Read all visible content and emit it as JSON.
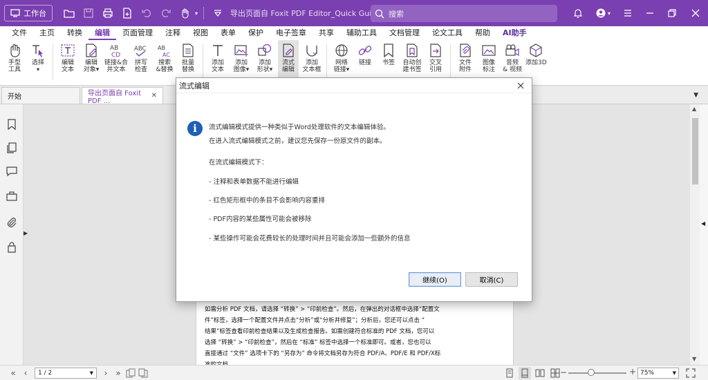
{
  "titlebar": {
    "home_label": "工作台",
    "doc_title": "导出页面自 Foxit PDF Editor_Quick Guide.pdf",
    "search_placeholder": "搜索"
  },
  "menu": {
    "tabs": [
      "文件",
      "主页",
      "转换",
      "编辑",
      "页面管理",
      "注释",
      "视图",
      "表单",
      "保护",
      "电子签章",
      "共享",
      "辅助工具",
      "文档管理",
      "论文工具",
      "帮助",
      "AI助手"
    ],
    "active": "编辑"
  },
  "ribbon": {
    "hand": "手型\n工具",
    "select": "选择",
    "edit_text": "编辑\n文本",
    "edit_object": "编辑\n对象▾",
    "link_merge": "链接&合\n并文本",
    "spell": "拼写\n检查",
    "search_replace": "搜索\n&替换",
    "batch_replace": "批量\n替换",
    "add_text": "添加\n文本",
    "add_image": "添加\n图像▾",
    "add_shape": "添加\n形状▾",
    "flow_edit": "流式\n编辑",
    "add_textbox": "添加\n文本框",
    "web_link": "网络\n链接▾",
    "link": "链接",
    "bookmark": "书签",
    "auto_bookmark": "自动创\n建书签",
    "cross_ref": "交叉\n引用",
    "file_attach": "文件\n附件",
    "image_annot": "图像\n标注",
    "audio_video": "音频\n& 视频",
    "add_3d": "添加3D"
  },
  "doctabs": {
    "start": "开始",
    "active": "导出页面自 Foxit PDF ...",
    "close": "✕",
    "dropdown": "▼"
  },
  "page": {
    "lines": [
      "如需分析 PDF 文档，请选择 “转换” > “印前检查”。然后，在弹出的对话框中选择“配置文",
      "件”标签，选择一个配置文件并点击“分析”或“分析并修复”；分析后，您还可以点击 “",
      "结果”标签查看印前检查结果以及生成检查报告。如需创建符合标准的 PDF 文档，您可以",
      "选择 “转换” > “印前检查”，然后在 “标准” 标签中选择一个标准即可。或者，您也可以",
      "直接通过 “文件” 选项卡下的 “另存为” 命令将文档另存为符合 PDF/A、PDF/E 和 PDF/X标",
      "准的文档。"
    ]
  },
  "status": {
    "page_value": "1 / 2",
    "zoom_value": "75%"
  },
  "dialog": {
    "title": "流式编辑",
    "line1": "流式编辑模式提供一种类似于Word处理软件的文本编辑体验。",
    "line2": "在进入流式编辑模式之前，建议您先保存一份原文件的副本。",
    "line3": "在流式编辑模式下：",
    "bullet1": "- 注释和表单数据不能进行编辑",
    "bullet2": "- 红色矩形框中的条目不会影响内容重排",
    "bullet3": "- PDF内容的某些属性可能会被移除",
    "bullet4": "- 某些操作可能会花费较长的处理时间并且可能会添加一些额外的信息",
    "continue_label": "继续(O)",
    "cancel_label": "取消(C)"
  },
  "colors": {
    "brand": "#7a3fb0",
    "info_icon": "#1e5fb4"
  }
}
